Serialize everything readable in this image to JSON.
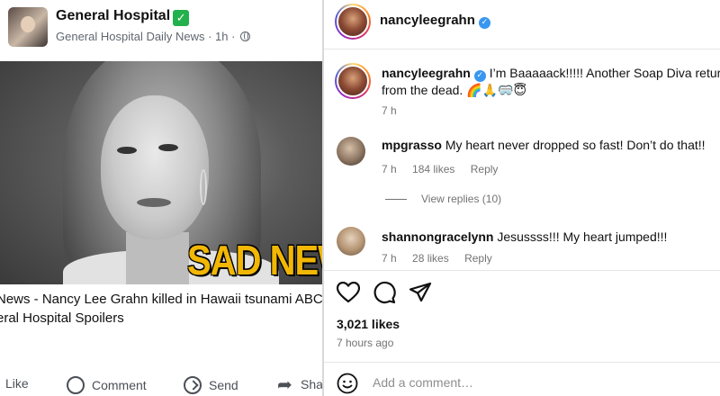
{
  "facebook": {
    "page_title": "General Hospital",
    "title_emoji": "✅",
    "subtitle": "General Hospital Daily News · 1h ·",
    "image_overlay": "SAD NEW",
    "caption_lines": [
      "News - Nancy Lee Grahn killed in Hawaii tsunami ABC",
      "eral Hospital Spoilers"
    ],
    "actions": {
      "like": "Like",
      "comment": "Comment",
      "send": "Send",
      "share": "Sha"
    }
  },
  "instagram": {
    "header_username": "nancyleegrahn",
    "caption": {
      "username": "nancyleegrahn",
      "text_line1": "I’m Baaaaack!!!!! Another Soap Diva returns",
      "text_line2": "from the dead. 🌈🙏🥽😇",
      "time": "7 h"
    },
    "comments": [
      {
        "username": "mpgrasso",
        "text": "My heart never dropped so fast! Don’t do that!!",
        "time": "7 h",
        "likes": "184 likes",
        "reply": "Reply"
      },
      {
        "username": "shannongracelynn",
        "text": "Jesussss!!! My heart jumped!!!",
        "time": "7 h",
        "likes": "28 likes",
        "reply": "Reply"
      }
    ],
    "view_replies": "View replies (10)",
    "likes_count": "3,021 likes",
    "posted_ago": "7 hours ago",
    "comment_placeholder": "Add a comment…",
    "verified_color": "#3897f0"
  }
}
